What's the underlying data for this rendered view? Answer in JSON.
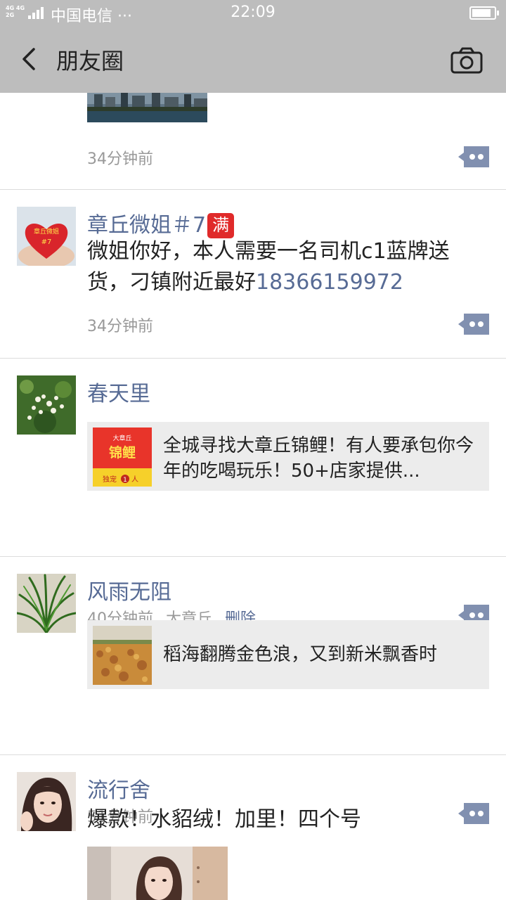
{
  "status_bar": {
    "network": [
      "4G 4G",
      "2G"
    ],
    "carrier": "中国电信 ···",
    "time": "22:09"
  },
  "nav": {
    "back_icon": "chevron-left-icon",
    "title": "朋友圈",
    "camera_icon": "camera-icon"
  },
  "posts": [
    {
      "time": "34分钟前",
      "image": "city-riverside-photo"
    },
    {
      "name": "章丘微姐＃7",
      "badge": "满",
      "avatar_text": [
        "章丘微姐",
        "#7"
      ],
      "text": "微姐你好，本人需要一名司机c1蓝牌送货，刁镇附近最好",
      "phone": "18366159972",
      "time": "34分钟前"
    },
    {
      "name": "春天里",
      "link": {
        "title": "全城寻找大章丘锦鲤！有人要承包你今年的吃喝玩乐！50+店家提供...",
        "thumb_text": [
          "大章丘",
          "锦鲤",
          "独宠",
          "1",
          "人"
        ]
      },
      "time": "40分钟前",
      "location": "大章丘",
      "delete_label": "删除"
    },
    {
      "name": "风雨无阻",
      "link": {
        "title": "稻海翻腾金色浪，又到新米飘香时"
      },
      "time": "51分钟前"
    },
    {
      "name": "流行舍",
      "text": "爆款！水貂绒！加里！四个号",
      "image": "product-photo"
    }
  ],
  "colors": {
    "bar_bg": "#bdbdbd",
    "link": "#576b95",
    "card_bg": "#ececec",
    "divider": "#dcdcdc"
  }
}
